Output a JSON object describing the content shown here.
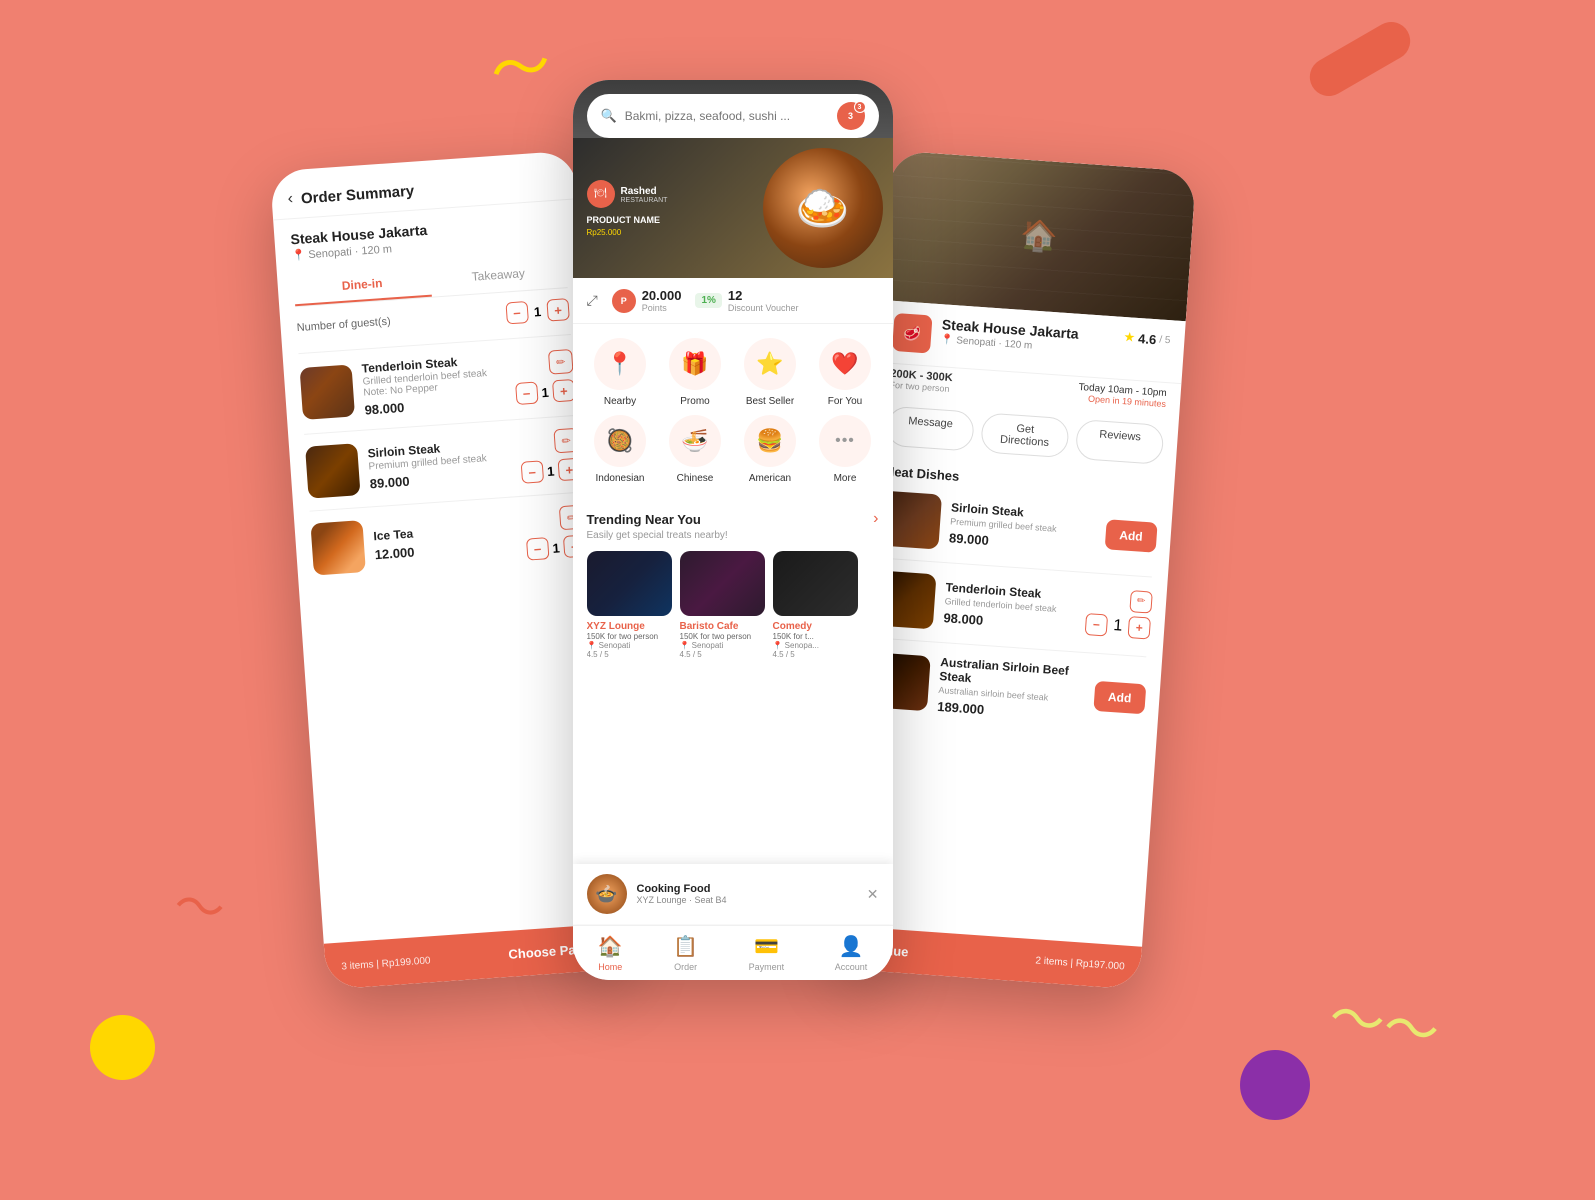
{
  "background": {
    "color": "#F08070"
  },
  "left_phone": {
    "title": "Order Summary",
    "restaurant": {
      "name": "Steak House Jakarta",
      "location": "Senopati · 120 m"
    },
    "tabs": {
      "dine_in": "Dine-in",
      "takeaway": "Takeaway"
    },
    "guest_label": "Number of guest(s)",
    "guest_count": "1",
    "items": [
      {
        "name": "Tenderloin Steak",
        "desc": "Grilled tenderloin beef steak",
        "note": "Note: No Pepper",
        "price": "98.000",
        "qty": "1",
        "img_class": "food-steak-1"
      },
      {
        "name": "Sirloin Steak",
        "desc": "Premium grilled beef steak",
        "note": "",
        "price": "89.000",
        "qty": "1",
        "img_class": "food-steak-2"
      },
      {
        "name": "Ice Tea",
        "desc": "",
        "note": "",
        "price": "12.000",
        "qty": "1",
        "img_class": "food-icetea"
      }
    ],
    "footer": {
      "items_count": "3 items",
      "total": "Rp199.000",
      "button": "Choose Payment"
    }
  },
  "center_phone": {
    "search": {
      "placeholder": "Bakmi, pizza, seafood, sushi ..."
    },
    "notification_count": "3",
    "banner": {
      "logo_text": "Rashed",
      "restaurant_label": "RESTAURANT",
      "product_label": "PRODUCT NAME",
      "price": "Rp25.000"
    },
    "points": {
      "value": "20.000",
      "label": "Points",
      "voucher_count": "12",
      "voucher_label": "Discount Voucher"
    },
    "categories": [
      {
        "icon": "📍",
        "label": "Nearby"
      },
      {
        "icon": "🎁",
        "label": "Promo"
      },
      {
        "icon": "⭐",
        "label": "Best Seller"
      },
      {
        "icon": "❤️",
        "label": "For You"
      },
      {
        "icon": "🥘",
        "label": "Indonesian"
      },
      {
        "icon": "🍜",
        "label": "Chinese"
      },
      {
        "icon": "🍔",
        "label": "American"
      },
      {
        "icon": "•••",
        "label": "More"
      }
    ],
    "trending": {
      "title": "Trending Near You",
      "subtitle": "Easily get special treats nearby!",
      "restaurants": [
        {
          "name": "XYZ Lounge",
          "price": "150K for two person",
          "location": "Senopati",
          "rating": "4.5 / 5",
          "img_class": "rest-img-1"
        },
        {
          "name": "Baristo Cafe",
          "price": "150K for two person",
          "location": "Senopati",
          "rating": "4.5 / 5",
          "img_class": "rest-img-2"
        },
        {
          "name": "Comedy",
          "price": "150K for t...",
          "location": "Senopa...",
          "rating": "4.5 / 5",
          "img_class": "rest-img-3"
        }
      ]
    },
    "notification": {
      "title": "Cooking Food",
      "subtitle": "XYZ Lounge · Seat B4"
    },
    "nav": [
      {
        "icon": "🏠",
        "label": "Home",
        "active": true
      },
      {
        "icon": "📋",
        "label": "Order",
        "active": false
      },
      {
        "icon": "💳",
        "label": "Payment",
        "active": false
      },
      {
        "icon": "👤",
        "label": "Account",
        "active": false
      }
    ]
  },
  "right_phone": {
    "restaurant": {
      "name": "Steak House Jakarta",
      "location": "Senopati · 120 m",
      "rating": "4.6",
      "rating_max": "/ 5",
      "price_range": "200K - 300K",
      "price_for": "For two person",
      "hours": "Today 10am - 10pm",
      "status": "Open in 19 minutes"
    },
    "action_buttons": [
      "Message",
      "Get Directions",
      "Reviews"
    ],
    "sections": [
      {
        "title": "Meat Dishes",
        "items": [
          {
            "name": "Sirloin Steak",
            "desc": "Premium grilled beef steak",
            "price": "89.000",
            "has_add": true,
            "has_qty": false,
            "img_class": "menu-img-1"
          },
          {
            "name": "Tenderloin Steak",
            "desc": "Grilled tenderloin beef steak",
            "price": "98.000",
            "has_add": false,
            "has_qty": true,
            "qty": "1",
            "img_class": "menu-img-2"
          },
          {
            "name": "Australian Sirloin Beef Steak",
            "desc": "Australian sirloin beef steak",
            "price": "189.000",
            "has_add": true,
            "has_qty": false,
            "img_class": "menu-img-3"
          }
        ]
      }
    ],
    "footer": {
      "button": "Continue",
      "items_count": "2 items",
      "total": "Rp197.000"
    }
  }
}
